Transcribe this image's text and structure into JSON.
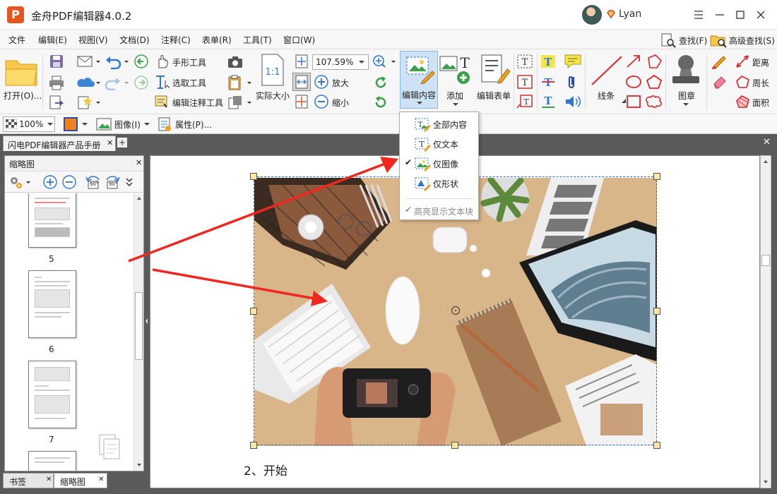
{
  "window": {
    "title": "金舟PDF编辑器4.0.2",
    "logo_letter": "P",
    "user": "Lyan"
  },
  "menu": {
    "items": [
      "文件",
      "编辑(E)",
      "视图(V)",
      "文档(D)",
      "注释(C)",
      "表单(R)",
      "工具(T)",
      "窗口(W)"
    ],
    "find": "查找(F)",
    "advanced_find": "高级查找(S)"
  },
  "ribbon": {
    "open": "打开(O)...",
    "hand_tool": "手形工具",
    "select_tool": "选取工具",
    "edit_annotation_tool": "编辑注释工具",
    "actual_size": "实际大小",
    "zoom_value": "107.59%",
    "zoom_in": "放大",
    "zoom_out": "缩小",
    "edit_content": "编辑内容",
    "add": "添加",
    "edit_form": "编辑表单",
    "line": "线条",
    "stamp": "图章",
    "distance": "距离",
    "perimeter": "周长",
    "area": "面积"
  },
  "toolbar2": {
    "opacity": "100%",
    "image_menu": "图像(I)",
    "properties": "属性(P)..."
  },
  "tabs": {
    "document": "闪电PDF编辑器产品手册"
  },
  "thumbnails": {
    "panel_title": "缩略图",
    "rotate_left": "90°",
    "rotate_right": "90°",
    "pages": [
      "5",
      "6",
      "7"
    ]
  },
  "bottom_tabs": {
    "bookmarks": "书签",
    "thumbnails": "缩略图"
  },
  "document": {
    "heading": "2、开始"
  },
  "dropdown": {
    "items": [
      {
        "label": "全部内容",
        "checked": false,
        "disabled": false
      },
      {
        "label": "仅文本",
        "checked": false,
        "disabled": false
      },
      {
        "label": "仅图像",
        "checked": true,
        "disabled": false
      },
      {
        "label": "仅形状",
        "checked": false,
        "disabled": false
      }
    ],
    "highlight_text_blocks": "高亮显示文本块"
  },
  "colors": {
    "accent": "#e8541d",
    "annotation_arrow": "#f0271f",
    "selection": "#2a6fc9"
  }
}
